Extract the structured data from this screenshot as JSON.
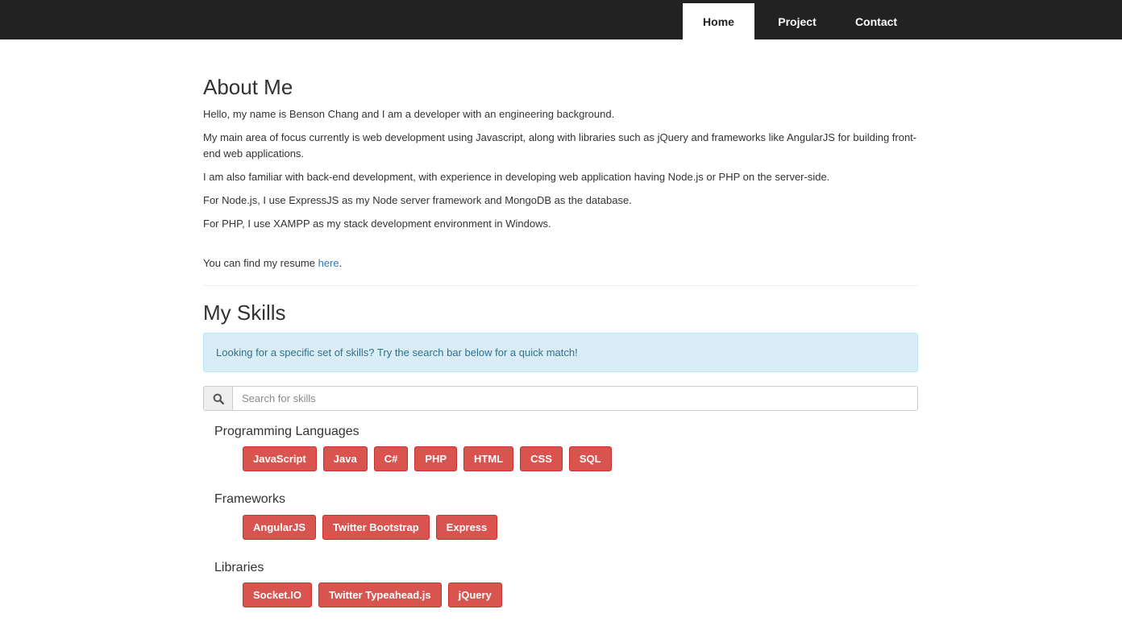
{
  "nav": {
    "items": [
      {
        "label": "Home",
        "active": true
      },
      {
        "label": "Project",
        "active": false
      },
      {
        "label": "Contact",
        "active": false
      }
    ]
  },
  "about": {
    "title": "About Me",
    "paragraphs": [
      "Hello, my name is Benson Chang and I am a developer with an engineering background.",
      "My main area of focus currently is web development using Javascript, along with libraries such as jQuery and frameworks like AngularJS for building front-end web applications.",
      "I am also familiar with back-end development, with experience in developing web application having Node.js or PHP on the server-side.",
      "For Node.js, I use ExpressJS as my Node server framework and MongoDB as the database.",
      "For PHP, I use XAMPP as my stack development environment in Windows."
    ],
    "resume_prefix": "You can find my resume ",
    "resume_link": "here",
    "resume_suffix": "."
  },
  "skills": {
    "title": "My Skills",
    "alert": "Looking for a specific set of skills? Try the search bar below for a quick match!",
    "search_placeholder": "Search for skills",
    "search_icon": "search-icon",
    "categories": [
      {
        "name": "Programming Languages",
        "items": [
          "JavaScript",
          "Java",
          "C#",
          "PHP",
          "HTML",
          "CSS",
          "SQL"
        ]
      },
      {
        "name": "Frameworks",
        "items": [
          "AngularJS",
          "Twitter Bootstrap",
          "Express"
        ]
      },
      {
        "name": "Libraries",
        "items": [
          "Socket.IO",
          "Twitter Typeahead.js",
          "jQuery"
        ]
      }
    ]
  },
  "colors": {
    "navbar": "#222222",
    "badge": "#d9534f",
    "alert_bg": "#d9edf7",
    "alert_text": "#31708f",
    "link": "#337ab7"
  }
}
